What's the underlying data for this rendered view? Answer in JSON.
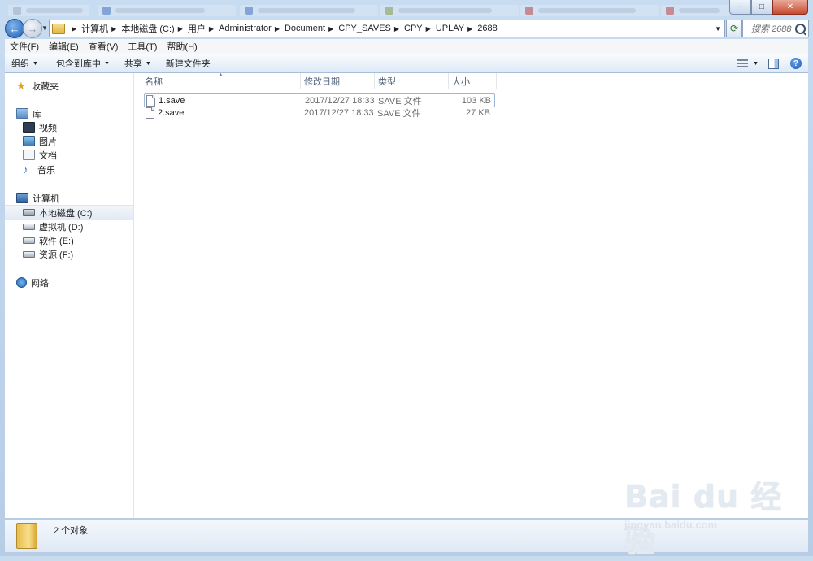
{
  "address": {
    "crumbs": [
      "计算机",
      "本地磁盘 (C:)",
      "用户",
      "Administrator",
      "Document",
      "CPY_SAVES",
      "CPY",
      "UPLAY",
      "2688"
    ]
  },
  "search": {
    "placeholder": "搜索 2688"
  },
  "menubar": [
    "文件(F)",
    "编辑(E)",
    "查看(V)",
    "工具(T)",
    "帮助(H)"
  ],
  "commandbar": {
    "organize": "组织",
    "include_library": "包含到库中",
    "share": "共享",
    "new_folder": "新建文件夹"
  },
  "navpane": {
    "favorites": "收藏夹",
    "libraries": "库",
    "library_items": [
      "视频",
      "图片",
      "文档",
      "音乐"
    ],
    "computer": "计算机",
    "drives": [
      "本地磁盘 (C:)",
      "虚拟机 (D:)",
      "软件 (E:)",
      "资源 (F:)"
    ],
    "network": "网络"
  },
  "columns": {
    "name": "名称",
    "date": "修改日期",
    "type": "类型",
    "size": "大小"
  },
  "files": [
    {
      "name": "1.save",
      "date": "2017/12/27 18:33",
      "type": "SAVE 文件",
      "size": "103 KB"
    },
    {
      "name": "2.save",
      "date": "2017/12/27 18:33",
      "type": "SAVE 文件",
      "size": "27 KB"
    }
  ],
  "status": {
    "count": "2 个对象"
  },
  "watermark": {
    "logo": "Bai du 经验",
    "url": "jingyan.baidu.com"
  }
}
